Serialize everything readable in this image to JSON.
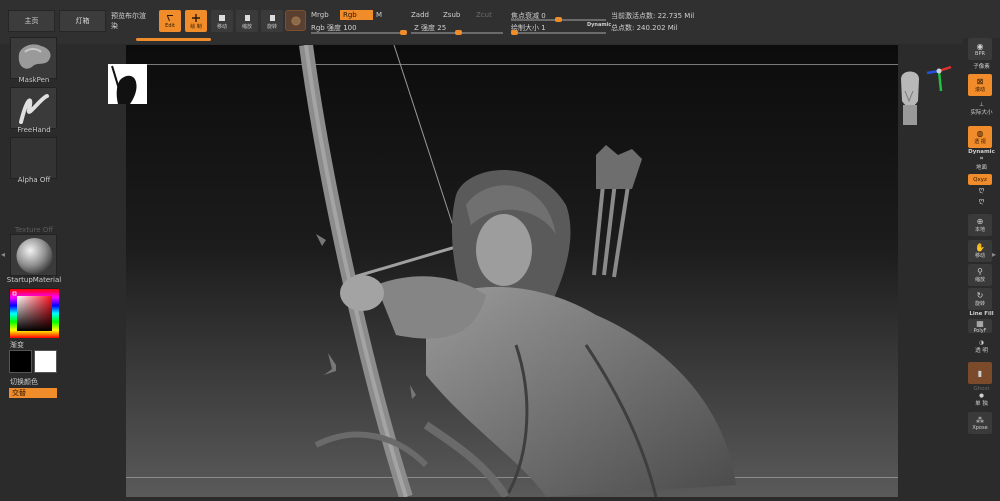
{
  "toolbar": {
    "home_tab": "主页",
    "lightbox_tab": "灯箱",
    "preview_bool_tab": "预览布尔渲染",
    "edit_label": "Edit",
    "draw_label": "绘 制",
    "move_label": "移动",
    "scale_label": "缩放",
    "rotate_label": "旋转",
    "mrgb_label": "Mrgb",
    "rgb_label": "Rgb",
    "m_label": "M",
    "rgb_intensity": "Rgb 强度 100",
    "zadd_label": "Zadd",
    "zsub_label": "Zsub",
    "zcut_label": "Zcut",
    "z_intensity": "Z 强度 25",
    "focal_shift": "焦点衰减 0",
    "draw_size": "绘制大小 1",
    "dynamic_label": "Dynamic",
    "active_points": "当前激活点数: 22.735 Mil",
    "total_points": "总点数: 240.202 Mil"
  },
  "left_shelf": {
    "brush1": "MaskPen",
    "brush2": "FreeHand",
    "alpha": "Alpha Off",
    "texture": "Texture Off",
    "material": "StartupMaterial",
    "gradient": "渐变",
    "switch_color": "切换颜色",
    "alternate": "交替"
  },
  "right_shelf": {
    "bpr": "BPR",
    "subpixel": "子像素",
    "scroll": "滚动",
    "actual": "实际大小",
    "dynamic": "Dynamic",
    "persp": "透 视",
    "floor": "地面",
    "xyz": "Qxyz",
    "local": "本地",
    "move": "移动",
    "zoom": "缩放",
    "rotate": "旋转",
    "linefill": "Line Fill",
    "polyf": "PolyF",
    "transp": "透 明",
    "ghost": "Ghost",
    "solo": "单 独",
    "xpose": "Xpose"
  },
  "colors": {
    "accent": "#f08c2a",
    "panel": "#2b2b2b",
    "button": "#3a3a3a"
  }
}
